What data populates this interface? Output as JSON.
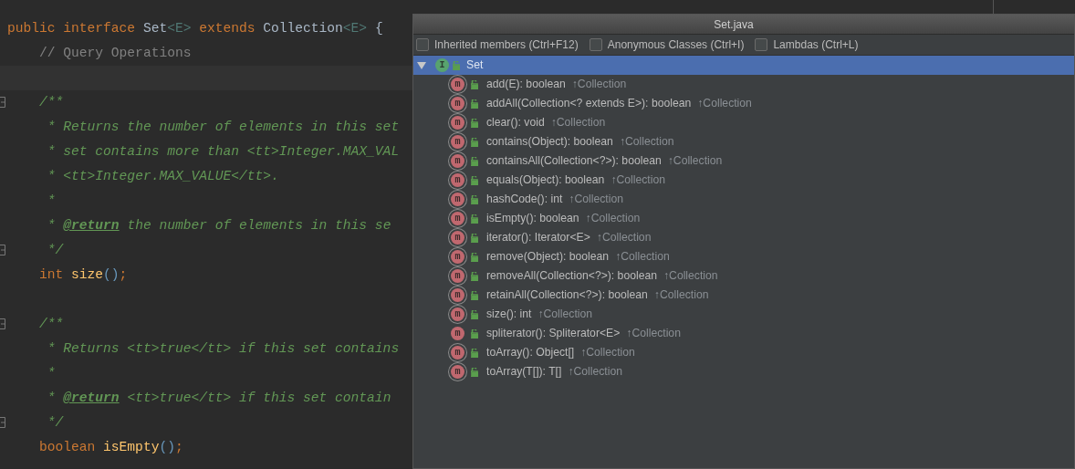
{
  "editor": {
    "lines": [
      {
        "kind": "code",
        "tokens": [
          {
            "kind": "keyword",
            "text": "public interface "
          },
          {
            "kind": "type",
            "text": "Set"
          },
          {
            "kind": "param",
            "text": "<E>"
          },
          {
            "kind": "keyword",
            "text": " extends "
          },
          {
            "kind": "type",
            "text": "Collection"
          },
          {
            "kind": "param",
            "text": "<E>"
          },
          {
            "kind": "plain",
            "text": " {"
          }
        ]
      },
      {
        "kind": "code",
        "tokens": [
          {
            "kind": "comment",
            "text": "    // Query Operations"
          }
        ]
      },
      {
        "kind": "blank",
        "current": true
      },
      {
        "kind": "code",
        "fold": true,
        "tokens": [
          {
            "kind": "doc",
            "text": "    /**"
          }
        ]
      },
      {
        "kind": "code",
        "tokens": [
          {
            "kind": "doc",
            "text": "     * Returns the number of elements in this set"
          }
        ]
      },
      {
        "kind": "code",
        "tokens": [
          {
            "kind": "doc",
            "text": "     * set contains more than <tt>Integer.MAX_VAL"
          }
        ]
      },
      {
        "kind": "code",
        "tokens": [
          {
            "kind": "doc",
            "text": "     * <tt>Integer.MAX_VALUE</tt>."
          }
        ]
      },
      {
        "kind": "code",
        "tokens": [
          {
            "kind": "doc",
            "text": "     *"
          }
        ]
      },
      {
        "kind": "code",
        "tokens": [
          {
            "kind": "doc",
            "text": "     * "
          },
          {
            "kind": "tag",
            "text": "@return"
          },
          {
            "kind": "doc",
            "text": " the number of elements in this se"
          }
        ]
      },
      {
        "kind": "code",
        "fold": true,
        "tokens": [
          {
            "kind": "doc",
            "text": "     */"
          }
        ]
      },
      {
        "kind": "code",
        "tokens": [
          {
            "kind": "keyword",
            "text": "    int "
          },
          {
            "kind": "method",
            "text": "size"
          },
          {
            "kind": "paren",
            "text": "()"
          },
          {
            "kind": "keyword",
            "text": ";"
          }
        ]
      },
      {
        "kind": "blank"
      },
      {
        "kind": "code",
        "fold": true,
        "tokens": [
          {
            "kind": "doc",
            "text": "    /**"
          }
        ]
      },
      {
        "kind": "code",
        "tokens": [
          {
            "kind": "doc",
            "text": "     * Returns <tt>true</tt> if this set contains"
          }
        ]
      },
      {
        "kind": "code",
        "tokens": [
          {
            "kind": "doc",
            "text": "     *"
          }
        ]
      },
      {
        "kind": "code",
        "tokens": [
          {
            "kind": "doc",
            "text": "     * "
          },
          {
            "kind": "tag",
            "text": "@return"
          },
          {
            "kind": "doc",
            "text": " <tt>true</tt> if this set contain"
          }
        ]
      },
      {
        "kind": "code",
        "fold": true,
        "tokens": [
          {
            "kind": "doc",
            "text": "     */"
          }
        ]
      },
      {
        "kind": "code",
        "tokens": [
          {
            "kind": "keyword",
            "text": "    boolean "
          },
          {
            "kind": "method",
            "text": "isEmpty"
          },
          {
            "kind": "paren",
            "text": "()"
          },
          {
            "kind": "keyword",
            "text": ";"
          }
        ]
      }
    ]
  },
  "structure_popup": {
    "title": "Set.java",
    "options": [
      {
        "label": "Inherited members (Ctrl+F12)",
        "checked": false
      },
      {
        "label": "Anonymous Classes (Ctrl+I)",
        "checked": false
      },
      {
        "label": "Lambdas (Ctrl+L)",
        "checked": false
      }
    ],
    "root": {
      "badge": "I",
      "name": "Set",
      "expanded": true,
      "selected": true,
      "children": [
        {
          "badge": "m",
          "abstract": true,
          "selected": false,
          "signature": "add(E): boolean",
          "origin": "↑Collection"
        },
        {
          "badge": "m",
          "abstract": true,
          "selected": false,
          "signature": "addAll(Collection<? extends E>): boolean",
          "origin": "↑Collection"
        },
        {
          "badge": "m",
          "abstract": true,
          "selected": false,
          "signature": "clear(): void",
          "origin": "↑Collection"
        },
        {
          "badge": "m",
          "abstract": true,
          "selected": false,
          "signature": "contains(Object): boolean",
          "origin": "↑Collection"
        },
        {
          "badge": "m",
          "abstract": true,
          "selected": false,
          "signature": "containsAll(Collection<?>): boolean",
          "origin": "↑Collection"
        },
        {
          "badge": "m",
          "abstract": true,
          "selected": false,
          "signature": "equals(Object): boolean",
          "origin": "↑Collection"
        },
        {
          "badge": "m",
          "abstract": true,
          "selected": false,
          "signature": "hashCode(): int",
          "origin": "↑Collection"
        },
        {
          "badge": "m",
          "abstract": true,
          "selected": false,
          "signature": "isEmpty(): boolean",
          "origin": "↑Collection"
        },
        {
          "badge": "m",
          "abstract": true,
          "selected": false,
          "signature": "iterator(): Iterator<E>",
          "origin": "↑Collection"
        },
        {
          "badge": "m",
          "abstract": true,
          "selected": false,
          "signature": "remove(Object): boolean",
          "origin": "↑Collection"
        },
        {
          "badge": "m",
          "abstract": true,
          "selected": false,
          "signature": "removeAll(Collection<?>): boolean",
          "origin": "↑Collection"
        },
        {
          "badge": "m",
          "abstract": true,
          "selected": false,
          "signature": "retainAll(Collection<?>): boolean",
          "origin": "↑Collection"
        },
        {
          "badge": "m",
          "abstract": true,
          "selected": false,
          "signature": "size(): int",
          "origin": "↑Collection"
        },
        {
          "badge": "m",
          "abstract": false,
          "selected": false,
          "signature": "spliterator(): Spliterator<E>",
          "origin": "↑Collection"
        },
        {
          "badge": "m",
          "abstract": true,
          "selected": false,
          "signature": "toArray(): Object[]",
          "origin": "↑Collection"
        },
        {
          "badge": "m",
          "abstract": true,
          "selected": false,
          "signature": "toArray(T[]): T[]",
          "origin": "↑Collection"
        }
      ]
    }
  }
}
